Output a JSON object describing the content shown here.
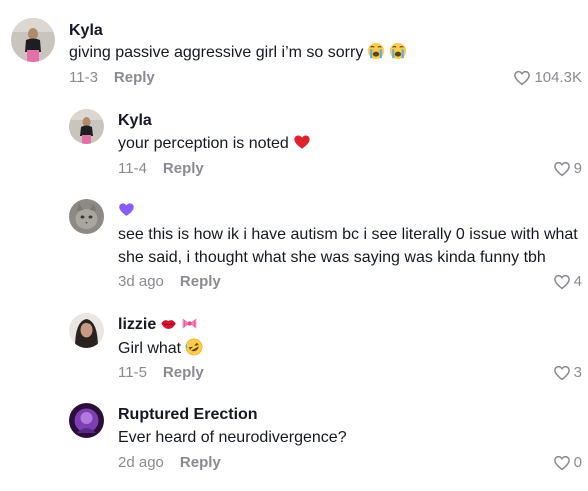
{
  "comments": [
    {
      "username": "Kyla",
      "text": "giving passive aggressive girl i’m so sorry",
      "emojis": [
        "loudly-crying-face-icon",
        "loudly-crying-face-icon"
      ],
      "date": "11-3",
      "reply_label": "Reply",
      "likes": "104.3K"
    },
    {
      "username": "Kyla",
      "text": "your perception is noted",
      "emojis": [
        "red-heart-icon"
      ],
      "date": "11-4",
      "reply_label": "Reply",
      "likes": "9"
    },
    {
      "username": "",
      "name_badge": "purple-heart-icon",
      "text": "see this is how ik i have autism bc i see literally 0 issue with what she said, i thought what she was saying was kinda funny tbh",
      "date": "3d ago",
      "reply_label": "Reply",
      "likes": "4"
    },
    {
      "username": "lizzie",
      "name_badges": [
        "lips-icon",
        "ribbon-bow-icon"
      ],
      "text": "Girl what",
      "emojis": [
        "rolling-laughing-face-icon"
      ],
      "date": "11-5",
      "reply_label": "Reply",
      "likes": "3"
    },
    {
      "username": "Ruptured Erection",
      "text": "Ever heard of neurodivergence?",
      "date": "2d ago",
      "reply_label": "Reply",
      "likes": "0"
    }
  ],
  "colors": {
    "text": "#161823",
    "meta": "#8a8b91",
    "heart_red": "#e0212e",
    "purple": "#8a5cf6"
  }
}
